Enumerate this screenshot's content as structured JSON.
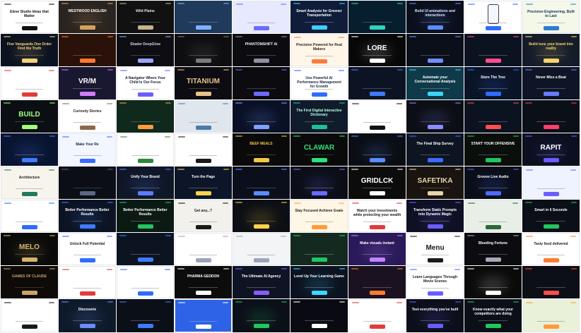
{
  "page": {
    "background": "#ffffff"
  },
  "tiles": [
    {
      "theme": "light",
      "bg": "#ffffff",
      "text": "#111111",
      "accent": "#111111",
      "title": "Eleve Studio Ideas that Matter"
    },
    {
      "theme": "dark",
      "bg": "#2a2420",
      "text": "#ffffff",
      "accent": "#d6a25b",
      "title": "WESTWOOD ENGLISH"
    },
    {
      "theme": "dark",
      "bg": "#111111",
      "text": "#e8e2d4",
      "accent": "#c7b38a",
      "title": "Wild Plains"
    },
    {
      "theme": "dark",
      "bg": "#1f3a5a",
      "text": "#ffffff",
      "accent": "#7fb2ff",
      "title": ""
    },
    {
      "theme": "light",
      "bg": "#e7e9ff",
      "text": "#202040",
      "accent": "#6a6cff",
      "title": ""
    },
    {
      "theme": "dark",
      "bg": "#0f1c3a",
      "text": "#ffffff",
      "accent": "#39d0ff",
      "title": "Smart Analysis for Greener Transportation"
    },
    {
      "theme": "dark",
      "bg": "#071e2e",
      "text": "#bff3ff",
      "accent": "#2dd4bf",
      "title": ""
    },
    {
      "theme": "dark",
      "bg": "#0a0f1c",
      "text": "#d7e3ff",
      "accent": "#5b8cff",
      "title": "Build UI animations and interactions"
    },
    {
      "theme": "light",
      "bg": "#ffffff",
      "text": "#1a1a1a",
      "accent": "#2f6bff",
      "title": ""
    },
    {
      "theme": "light",
      "bg": "#f4f8e8",
      "text": "#14305a",
      "accent": "#2d7bd6",
      "title": "Precision Engineering. Built to Last"
    },
    {
      "theme": "dark",
      "bg": "#0b1220",
      "text": "#f4d27a",
      "accent": "#f4d27a",
      "title": "Five Vanguards One Order Find the Truth"
    },
    {
      "theme": "dark",
      "bg": "#2a120a",
      "text": "#ffd7a1",
      "accent": "#ff7a2f",
      "title": ""
    },
    {
      "theme": "dark",
      "bg": "#0d0d12",
      "text": "#d4d4e3",
      "accent": "#9aa4ff",
      "title": "Shader DeepGlow"
    },
    {
      "theme": "dark",
      "bg": "#0e0e10",
      "text": "#d8d8d8",
      "accent": "#7a7a7a",
      "title": ""
    },
    {
      "theme": "dark",
      "bg": "#0c0c10",
      "text": "#eaeaf0",
      "accent": "#8f8fa3",
      "title": "PHANTOMSHIFT AI"
    },
    {
      "theme": "light",
      "bg": "#fff6e9",
      "text": "#2b1c10",
      "accent": "#ff7a3d",
      "title": "Precision Powered for Real Makers"
    },
    {
      "theme": "dark",
      "bg": "#070707",
      "text": "#ffffff",
      "accent": "#ffffff",
      "title": "LORE"
    },
    {
      "theme": "dark",
      "bg": "#0b0f1a",
      "text": "#dfe7ff",
      "accent": "#6f8dff",
      "title": ""
    },
    {
      "theme": "dark",
      "bg": "#0b1220",
      "text": "#ffffff",
      "accent": "#ff4d8d",
      "title": ""
    },
    {
      "theme": "dark",
      "bg": "#141c2a",
      "text": "#f5d36a",
      "accent": "#f5d36a",
      "title": "Build tune your brand into reality"
    },
    {
      "theme": "light",
      "bg": "#ffffff",
      "text": "#1b1b1b",
      "accent": "#e23b3b",
      "title": ""
    },
    {
      "theme": "dark",
      "bg": "#1a1830",
      "text": "#ffffff",
      "accent": "#d17cff",
      "title": "VR/M"
    },
    {
      "theme": "light",
      "bg": "#ffffff",
      "text": "#1a1a2e",
      "accent": "#6b5cff",
      "title": "A Navigator Where Your Child Is Our Focus"
    },
    {
      "theme": "dark",
      "bg": "#0c0c12",
      "text": "#e8c48a",
      "accent": "#e8c48a",
      "title": "TITANIUM"
    },
    {
      "theme": "dark",
      "bg": "#0b0b10",
      "text": "#cfcfe0",
      "accent": "#6b6bff",
      "title": ""
    },
    {
      "theme": "light",
      "bg": "#ffffff",
      "text": "#1a2340",
      "accent": "#2f6bff",
      "title": "Use Powerful AI Performance Management for Growth"
    },
    {
      "theme": "dark",
      "bg": "#0c1424",
      "text": "#d4e1ff",
      "accent": "#3e7bff",
      "title": ""
    },
    {
      "theme": "dark",
      "bg": "#0f3a4a",
      "text": "#ffffff",
      "accent": "#3bd5ff",
      "title": "Automate your Conversational Analysis"
    },
    {
      "theme": "dark",
      "bg": "#0b1426",
      "text": "#ffffff",
      "accent": "#2f6bff",
      "title": "Store The Tree"
    },
    {
      "theme": "dark",
      "bg": "#0e1526",
      "text": "#ffffff",
      "accent": "#6a7cff",
      "title": "Never Miss a Beat"
    },
    {
      "theme": "dark",
      "bg": "#0b0f14",
      "text": "#9fff7a",
      "accent": "#9fff7a",
      "title": "BUILD"
    },
    {
      "theme": "light",
      "bg": "#ffffff",
      "text": "#2a2420",
      "accent": "#8a6a4a",
      "title": "Curiosity Stories"
    },
    {
      "theme": "dark",
      "bg": "#0f2a1c",
      "text": "#ffe9b8",
      "accent": "#ff9b3d",
      "title": ""
    },
    {
      "theme": "light",
      "bg": "#dfe6ee",
      "text": "#1a2a3a",
      "accent": "#4a7aa8",
      "title": ""
    },
    {
      "theme": "dark",
      "bg": "#0a1026",
      "text": "#d8e2ff",
      "accent": "#7fa2ff",
      "title": ""
    },
    {
      "theme": "dark",
      "bg": "#101c2c",
      "text": "#b8ffe8",
      "accent": "#19c29a",
      "title": "The First Digital Interactive Dictionary"
    },
    {
      "theme": "light",
      "bg": "#ffffff",
      "text": "#1a1a1a",
      "accent": "#111111",
      "title": ""
    },
    {
      "theme": "dark",
      "bg": "#0b0e14",
      "text": "#d6d6e6",
      "accent": "#8c8cff",
      "title": ""
    },
    {
      "theme": "dark",
      "bg": "#0b1220",
      "text": "#ffffff",
      "accent": "#ff4d4d",
      "title": ""
    },
    {
      "theme": "dark",
      "bg": "#0b0f18",
      "text": "#ffffff",
      "accent": "#ff3d6e",
      "title": ""
    },
    {
      "theme": "dark",
      "bg": "#0a1430",
      "text": "#ffffff",
      "accent": "#3e7bff",
      "title": ""
    },
    {
      "theme": "light",
      "bg": "#f2f6ff",
      "text": "#13254a",
      "accent": "#3a6cff",
      "title": "Make Your Re"
    },
    {
      "theme": "light",
      "bg": "#ffffff",
      "text": "#1a1a1a",
      "accent": "#2a8a3a",
      "title": ""
    },
    {
      "theme": "light",
      "bg": "#ffffff",
      "text": "#1a1a1a",
      "accent": "#1a1a1a",
      "title": ""
    },
    {
      "theme": "dark",
      "bg": "#0a0a0a",
      "text": "#f1c74a",
      "accent": "#f1c74a",
      "title": "BEEF MEALS"
    },
    {
      "theme": "dark",
      "bg": "#0a0a0a",
      "text": "#2ee07c",
      "accent": "#2ee07c",
      "title": "CLAWAR"
    },
    {
      "theme": "dark",
      "bg": "#0a0d14",
      "text": "#d6e2ff",
      "accent": "#5a8cff",
      "title": ""
    },
    {
      "theme": "dark",
      "bg": "#0e1522",
      "text": "#ffffff",
      "accent": "#3a6cff",
      "title": "The Final Ship Survey"
    },
    {
      "theme": "dark",
      "bg": "#0a0f0c",
      "text": "#ffffff",
      "accent": "#22c55e",
      "title": "START YOUR OFFENSIVE"
    },
    {
      "theme": "dark",
      "bg": "#0b0f1e",
      "text": "#ffffff",
      "accent": "#6b5cff",
      "title": "RAPIT"
    },
    {
      "theme": "light",
      "bg": "#f7f4ec",
      "text": "#1e1e1e",
      "accent": "#1f7a5c",
      "title": "Architecture"
    },
    {
      "theme": "dark",
      "bg": "#0b0e14",
      "text": "#a9b2c3",
      "accent": "#5a6a86",
      "title": ""
    },
    {
      "theme": "dark",
      "bg": "#0f1626",
      "text": "#ffffff",
      "accent": "#5a7cff",
      "title": "Unify Your Brand"
    },
    {
      "theme": "dark",
      "bg": "#0c1628",
      "text": "#ffffff",
      "accent": "#ffd24a",
      "title": "Turn the Page"
    },
    {
      "theme": "dark",
      "bg": "#0b0f1c",
      "text": "#d7e1ff",
      "accent": "#5a8cff",
      "title": ""
    },
    {
      "theme": "dark",
      "bg": "#0b0e16",
      "text": "#ffffff",
      "accent": "#6b6bff",
      "title": ""
    },
    {
      "theme": "dark",
      "bg": "#0c0c0c",
      "text": "#ffffff",
      "accent": "#ffffff",
      "title": "GRIDLCK"
    },
    {
      "theme": "dark",
      "bg": "#1a1410",
      "text": "#e8d4a8",
      "accent": "#e8d4a8",
      "title": "SAFETIKA"
    },
    {
      "theme": "dark",
      "bg": "#0a0e18",
      "text": "#ffffff",
      "accent": "#4d6bff",
      "title": "Groove Live Audio"
    },
    {
      "theme": "light",
      "bg": "#eef3ff",
      "text": "#1a2340",
      "accent": "#6b5cff",
      "title": ""
    },
    {
      "theme": "light",
      "bg": "#ffffff",
      "text": "#1a1a1a",
      "accent": "#2f6bff",
      "title": ""
    },
    {
      "theme": "dark",
      "bg": "#0c1424",
      "text": "#ffffff",
      "accent": "#3e7bff",
      "title": "Better Performance Better Results"
    },
    {
      "theme": "dark",
      "bg": "#0c1a14",
      "text": "#ffffff",
      "accent": "#22c55e",
      "title": "Better Performance Better Results"
    },
    {
      "theme": "light",
      "bg": "#f3f1ec",
      "text": "#1a1a1a",
      "accent": "#1a1a1a",
      "title": "Get any...?"
    },
    {
      "theme": "dark",
      "bg": "#0c0f14",
      "text": "#ffd24a",
      "accent": "#ffd24a",
      "title": ""
    },
    {
      "theme": "light",
      "bg": "#fff7e6",
      "text": "#1a1a1a",
      "accent": "#ff9b3d",
      "title": "Stay Focused Achieve Goals"
    },
    {
      "theme": "light",
      "bg": "#ffffff",
      "text": "#1a1a1a",
      "accent": "#e23b3b",
      "title": "Watch your investments while protecting your wealth"
    },
    {
      "theme": "dark",
      "bg": "#0e1024",
      "text": "#ffffff",
      "accent": "#6b5cff",
      "title": "Transform Static Prompts into Dynamic Magic"
    },
    {
      "theme": "light",
      "bg": "#e8efe6",
      "text": "#1a1a1a",
      "accent": "#2a6a3a",
      "title": ""
    },
    {
      "theme": "dark",
      "bg": "#0b0f18",
      "text": "#ffffff",
      "accent": "#22c55e",
      "title": "Smart in 6 Seconds"
    },
    {
      "theme": "dark",
      "bg": "#0a0a0a",
      "text": "#d6b46a",
      "accent": "#d6b46a",
      "title": "MELO"
    },
    {
      "theme": "light",
      "bg": "#ffffff",
      "text": "#1a1a1a",
      "accent": "#2f6bff",
      "title": "Unlock Full Potential"
    },
    {
      "theme": "dark",
      "bg": "#0c1422",
      "text": "#ffffff",
      "accent": "#3e7bff",
      "title": ""
    },
    {
      "theme": "light",
      "bg": "#ffffff",
      "text": "#1a1a1a",
      "accent": "#9aa4b8",
      "title": ""
    },
    {
      "theme": "light",
      "bg": "#f3f4f6",
      "text": "#1a1a1a",
      "accent": "#9aa4b8",
      "title": ""
    },
    {
      "theme": "dark",
      "bg": "#142a20",
      "text": "#ffffff",
      "accent": "#22c55e",
      "title": ""
    },
    {
      "theme": "dark",
      "bg": "#2a1a5a",
      "text": "#ffffff",
      "accent": "#c084fc",
      "title": "Make visuals instant"
    },
    {
      "theme": "light",
      "bg": "#ffffff",
      "text": "#1a1a1a",
      "accent": "#1a1a1a",
      "title": "Menu"
    },
    {
      "theme": "dark",
      "bg": "#0c0c10",
      "text": "#ffffff",
      "accent": "#a8a8b8",
      "title": "Bleeding Fortune"
    },
    {
      "theme": "light",
      "bg": "#ffffff",
      "text": "#1a1a1a",
      "accent": "#ff7a2f",
      "title": "Tasty food delivered"
    },
    {
      "theme": "dark",
      "bg": "#0e0a08",
      "text": "#c8a46a",
      "accent": "#c8a46a",
      "title": "GAMES OF CLAUDE"
    },
    {
      "theme": "light",
      "bg": "#ffffff",
      "text": "#1a1a1a",
      "accent": "#e23b3b",
      "title": ""
    },
    {
      "theme": "light",
      "bg": "#ffffff",
      "text": "#1a1a1a",
      "accent": "#2f6bff",
      "title": ""
    },
    {
      "theme": "dark",
      "bg": "#0c0c0c",
      "text": "#ffffff",
      "accent": "#ffffff",
      "title": "PHARMA GEDDON"
    },
    {
      "theme": "dark",
      "bg": "#0e1424",
      "text": "#ffffff",
      "accent": "#8a5cff",
      "title": "The Ultimate AI Agency"
    },
    {
      "theme": "dark",
      "bg": "#0b1220",
      "text": "#ffffff",
      "accent": "#3ed5ff",
      "title": "Level Up Your Learning Game"
    },
    {
      "theme": "dark",
      "bg": "#1a1220",
      "text": "#ffffff",
      "accent": "#ff7a2f",
      "title": ""
    },
    {
      "theme": "light",
      "bg": "#ffffff",
      "text": "#1a1a1a",
      "accent": "#6b5cff",
      "title": "Learn Languages Through Movie Scenes"
    },
    {
      "theme": "dark",
      "bg": "#0a0a0a",
      "text": "#ffffff",
      "accent": "#ffffff",
      "title": ""
    },
    {
      "theme": "dark",
      "bg": "#0c0f16",
      "text": "#ffffff",
      "accent": "#ff4d4d",
      "title": ""
    },
    {
      "theme": "light",
      "bg": "#ffffff",
      "text": "#1a1a1a",
      "accent": "#1a1a1a",
      "title": ""
    },
    {
      "theme": "dark",
      "bg": "#0e1a2a",
      "text": "#ffffff",
      "accent": "#6a8cff",
      "title": "Discoverie"
    },
    {
      "theme": "dark",
      "bg": "#0b0f18",
      "text": "#ffffff",
      "accent": "#3e7bff",
      "title": ""
    },
    {
      "theme": "light",
      "bg": "#2e63e8",
      "text": "#ffffff",
      "accent": "#ffffff",
      "title": ""
    },
    {
      "theme": "dark",
      "bg": "#0b0f18",
      "text": "#ffffff",
      "accent": "#22c55e",
      "title": ""
    },
    {
      "theme": "dark",
      "bg": "#0a0a12",
      "text": "#ffffff",
      "accent": "#ffffff",
      "title": ""
    },
    {
      "theme": "light",
      "bg": "#ffffff",
      "text": "#1a1a1a",
      "accent": "#e23b3b",
      "title": ""
    },
    {
      "theme": "dark",
      "bg": "#0c0f1a",
      "text": "#ffffff",
      "accent": "#6b5cff",
      "title": "Test everything you've built"
    },
    {
      "theme": "dark",
      "bg": "#0b0f18",
      "text": "#ffffff",
      "accent": "#22c55e",
      "title": "Know exactly what your competitors are doing"
    },
    {
      "theme": "light",
      "bg": "#e9f1d8",
      "text": "#1a1a1a",
      "accent": "#ff9b3d",
      "title": ""
    }
  ]
}
